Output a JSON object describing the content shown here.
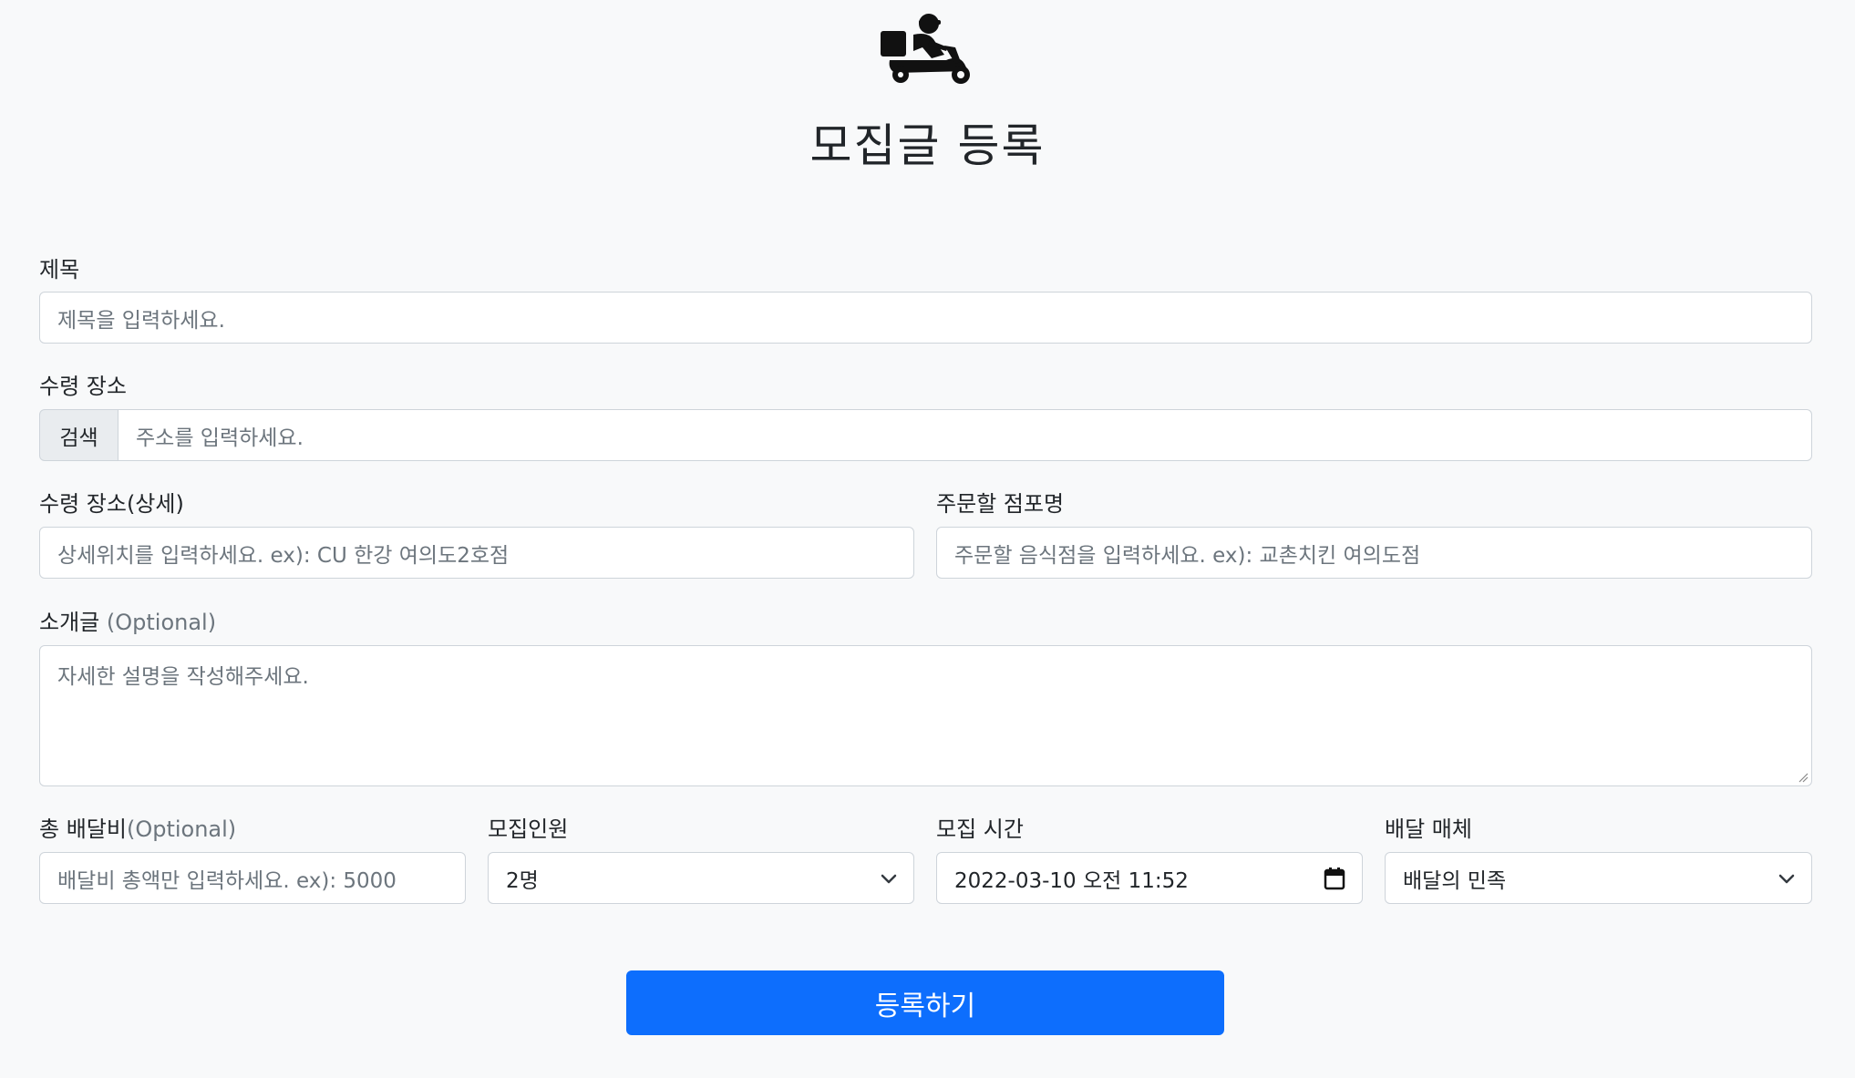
{
  "logo_icon": "delivery-scooter-icon",
  "page_title": "모집글 등록",
  "form": {
    "title_label": "제목",
    "title_placeholder": "제목을 입력하세요.",
    "pickup_label": "수령 장소",
    "search_button": "검색",
    "address_placeholder": "주소를 입력하세요.",
    "pickup_detail_label": "수령 장소(상세)",
    "pickup_detail_placeholder": "상세위치를 입력하세요. ex): CU 한강 여의도2호점",
    "store_label": "주문할 점포명",
    "store_placeholder": "주문할 음식점을 입력하세요. ex): 교촌치킨 여의도점",
    "intro_label": "소개글",
    "intro_optional": "(Optional)",
    "intro_placeholder": "자세한 설명을 작성해주세요.",
    "fee_label": "총 배달비",
    "fee_optional": "(Optional)",
    "fee_placeholder": "배달비 총액만 입력하세요. ex): 5000",
    "people_label": "모집인원",
    "people_value": "2명",
    "time_label": "모집 시간",
    "time_value": "2022-03-10 오전 11:52",
    "platform_label": "배달 매체",
    "platform_value": "배달의 민족",
    "submit_label": "등록하기"
  },
  "colors": {
    "primary": "#0d6efd",
    "background": "#f8f9fa",
    "border": "#ced4da",
    "placeholder": "#6c757d"
  }
}
